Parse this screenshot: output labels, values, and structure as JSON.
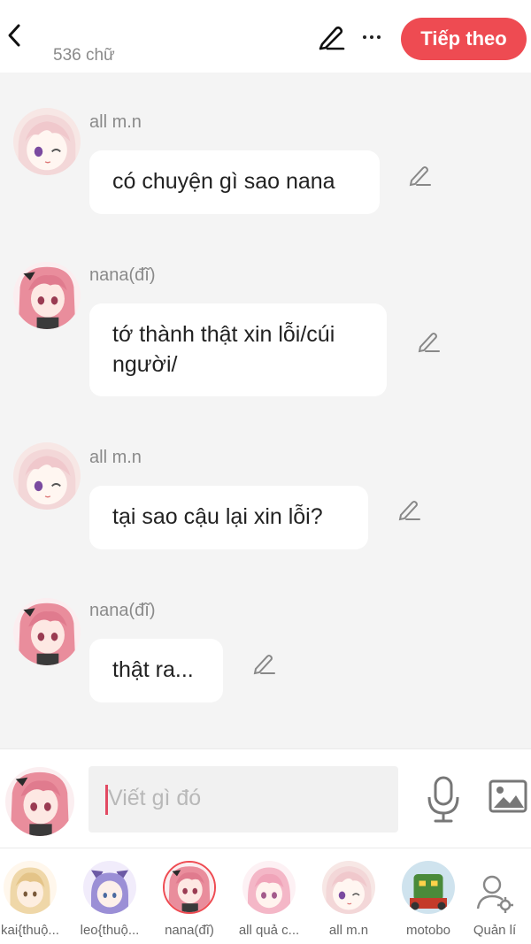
{
  "header": {
    "word_count": "536 chữ",
    "next_label": "Tiếp theo",
    "icons": {
      "back": "chevron-left-icon",
      "edit": "pencil-icon",
      "more": "more-horizontal-icon"
    }
  },
  "messages": [
    {
      "sender": "all m.n",
      "text": "có chuyện gì sao nana",
      "avatar": "white-hair-character"
    },
    {
      "sender": "nana(đĩ)",
      "text": "tớ thành thật xin lỗi/cúi người/",
      "avatar": "pink-hair-character"
    },
    {
      "sender": "all m.n",
      "text": "tại sao cậu lại xin lỗi?",
      "avatar": "white-hair-character"
    },
    {
      "sender": "nana(đĩ)",
      "text": "thật ra...",
      "avatar": "pink-hair-character"
    }
  ],
  "composer": {
    "placeholder": "Viết gì đó",
    "icons": {
      "mic": "microphone-icon",
      "image": "image-icon"
    }
  },
  "characters": [
    {
      "name": "kai{thuộ...",
      "selected": false
    },
    {
      "name": "leo{thuộ...",
      "selected": false
    },
    {
      "name": "nana(đĩ)",
      "selected": true
    },
    {
      "name": "all quả c...",
      "selected": false
    },
    {
      "name": "all m.n",
      "selected": false
    },
    {
      "name": "motobo",
      "selected": false
    },
    {
      "name": "Quản lí",
      "selected": false
    }
  ],
  "colors": {
    "accent": "#ee4b52",
    "background": "#f4f4f4",
    "bubble": "#ffffff"
  }
}
